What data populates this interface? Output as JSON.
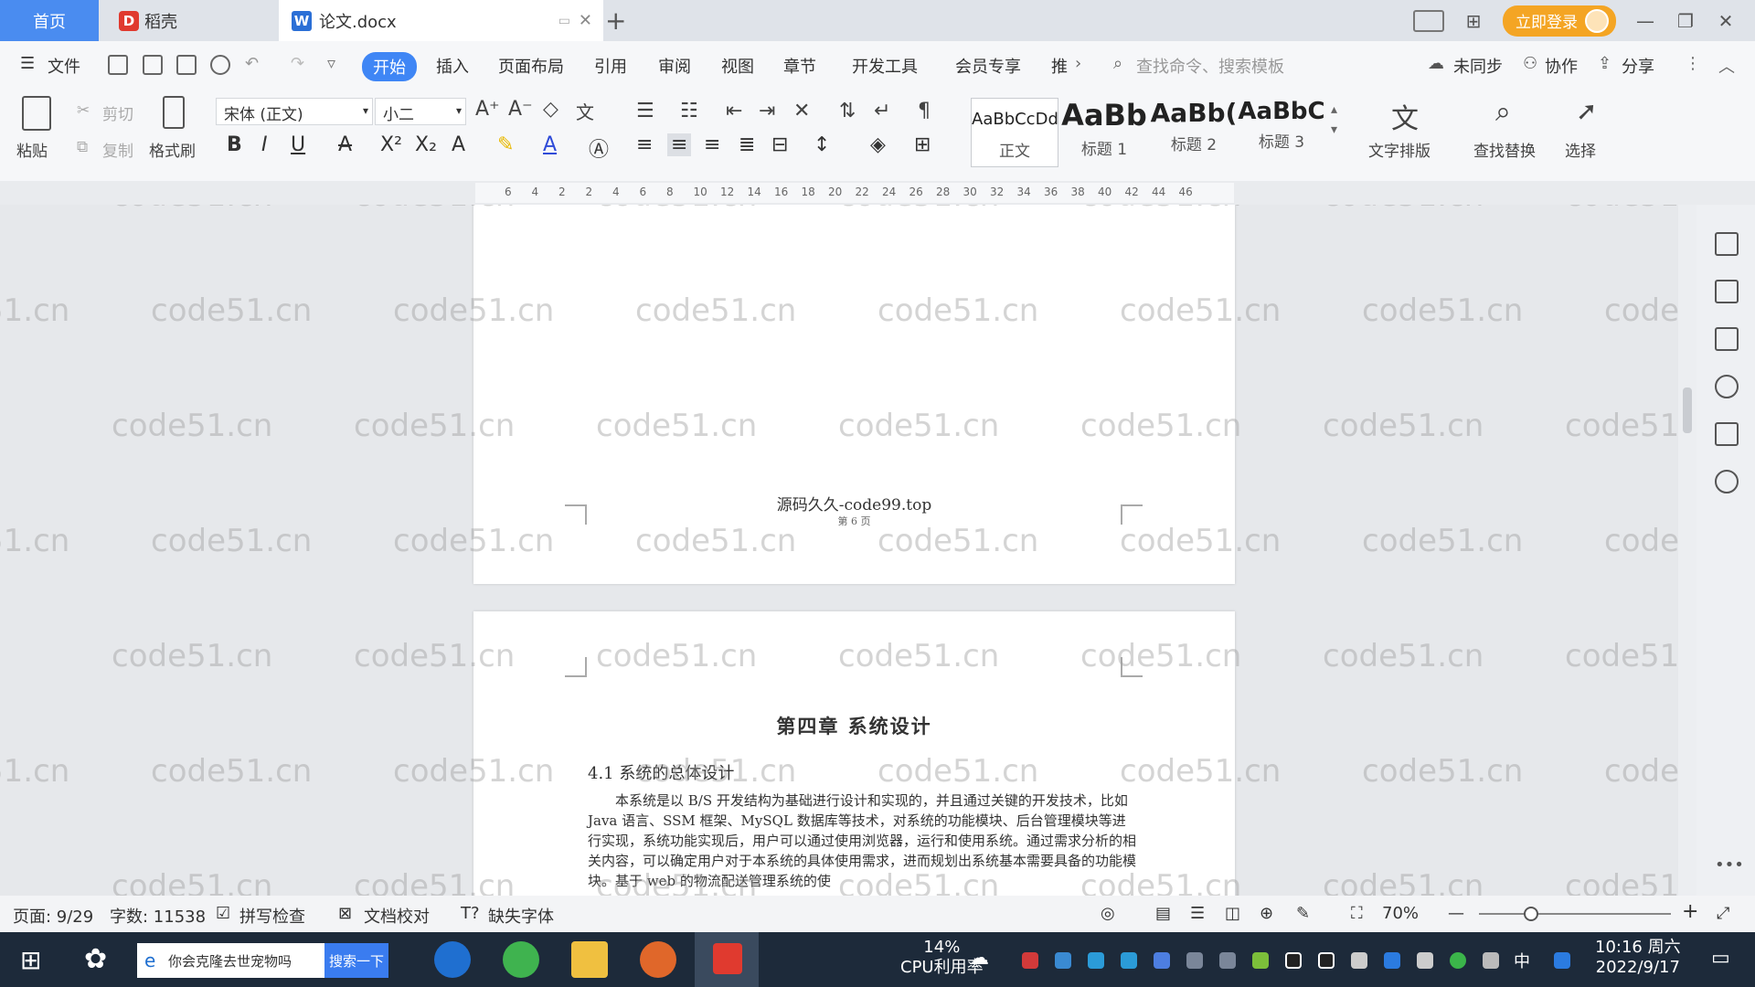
{
  "tabs": {
    "home": "首页",
    "daoke": "稻壳",
    "doc": "论文.docx",
    "add": "+"
  },
  "titlebar": {
    "login": "立即登录"
  },
  "menu": {
    "file": "文件",
    "items": [
      "开始",
      "插入",
      "页面布局",
      "引用",
      "审阅",
      "视图",
      "章节",
      "开发工具",
      "会员专享",
      "推"
    ],
    "search_cmd": "查找命令、搜索模板",
    "unsynced": "未同步",
    "collab": "协作",
    "share": "分享"
  },
  "ribbon": {
    "paste": "粘贴",
    "cut": "剪切",
    "copy": "复制",
    "format_painter": "格式刷",
    "font_name": "宋体 (正文)",
    "font_size": "小二",
    "styles": [
      {
        "preview": "AaBbCcDd",
        "label": "正文"
      },
      {
        "preview": "AaBb",
        "label": "标题 1"
      },
      {
        "preview": "AaBb(",
        "label": "标题 2"
      },
      {
        "preview": "AaBbC",
        "label": "标题 3"
      }
    ],
    "text_layout": "文字排版",
    "find_replace": "查找替换",
    "select": "选择"
  },
  "ruler": {
    "ticks": [
      "6",
      "4",
      "2",
      "2",
      "4",
      "6",
      "8",
      "10",
      "12",
      "14",
      "16",
      "18",
      "20",
      "22",
      "24",
      "26",
      "28",
      "30",
      "32",
      "34",
      "36",
      "38",
      "40",
      "42",
      "44",
      "46"
    ]
  },
  "document": {
    "footer_title": "源码久久-code99.top",
    "footer_page": "第 6 页",
    "chapter": "第四章  系统设计",
    "section": "4.1 系统的总体设计",
    "paragraph": "本系统是以 B/S 开发结构为基础进行设计和实现的，并且通过关键的开发技术，比如 Java 语言、SSM 框架、MySQL 数据库等技术，对系统的功能模块、后台管理模块等进行实现，系统功能实现后，用户可以通过使用浏览器，运行和使用系统。通过需求分析的相关内容，可以确定用户对于本系统的具体使用需求，进而规划出系统基本需要具备的功能模块。基于 web 的物流配送管理系统的使"
  },
  "watermark": "code51.cn",
  "status": {
    "page": "页面: 9/29",
    "words": "字数: 11538",
    "spell": "拼写检查",
    "proof": "文档校对",
    "missing_font": "缺失字体",
    "zoom": "70%",
    "zoom_level": 0.27
  },
  "taskbar": {
    "search_text": "你会克隆去世宠物吗",
    "search_btn": "搜索一下",
    "cpu_percent": "14%",
    "cpu_label": "CPU利用率",
    "time": "10:16 周六",
    "date": "2022/9/17",
    "ime": "中"
  }
}
